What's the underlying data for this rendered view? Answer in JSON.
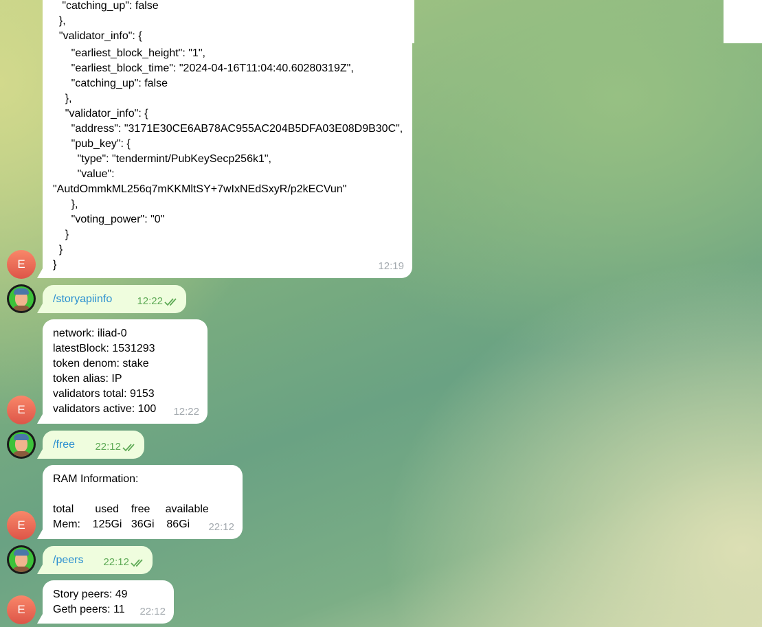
{
  "fragment": {
    "lines": [
      "   \"catching_up\": false",
      "  },",
      "  \"validator_info\": {",
      "    \"address\": \"3171E30CE6AB78AC955AC204B5DFA03E08D9B30C\","
    ]
  },
  "messages": {
    "json_reply": {
      "lines": [
        "      \"earliest_block_height\": \"1\",",
        "      \"earliest_block_time\": \"2024-04-16T11:04:40.60280319Z\",",
        "      \"catching_up\": false",
        "    },",
        "    \"validator_info\": {",
        "      \"address\": \"3171E30CE6AB78AC955AC204B5DFA03E08D9B30C\",",
        "      \"pub_key\": {",
        "        \"type\": \"tendermint/PubKeySecp256k1\",",
        "        \"value\":",
        "\"AutdOmmkML256q7mKKMltSY+7wIxNEdSxyR/p2kECVun\"",
        "      },",
        "      \"voting_power\": \"0\"",
        "    }",
        "  }",
        "}"
      ],
      "time": "12:19",
      "avatar_letter": "E"
    },
    "cmd_storyapiinfo": {
      "text": "/storyapiinfo",
      "time": "12:22"
    },
    "apiinfo_reply": {
      "lines": [
        "network: iliad-0",
        "latestBlock: 1531293",
        "token denom: stake",
        "token alias: IP",
        "validators total: 9153",
        "validators active: 100"
      ],
      "time": "12:22",
      "avatar_letter": "E"
    },
    "cmd_free": {
      "text": "/free",
      "time": "22:12"
    },
    "free_reply": {
      "lines": [
        "RAM Information:",
        "",
        "total       used    free     available",
        "Mem:    125Gi   36Gi    86Gi"
      ],
      "time": "22:12",
      "avatar_letter": "E"
    },
    "cmd_peers": {
      "text": "/peers",
      "time": "22:12"
    },
    "peers_reply": {
      "lines": [
        "Story peers: 49",
        "Geth peers: 11"
      ],
      "time": "22:12",
      "avatar_letter": "E"
    }
  },
  "colors": {
    "outgoing_bubble": "#effdde",
    "incoming_bubble": "#ffffff",
    "command_link": "#2a8fd0",
    "read_check": "#5eaa56"
  }
}
